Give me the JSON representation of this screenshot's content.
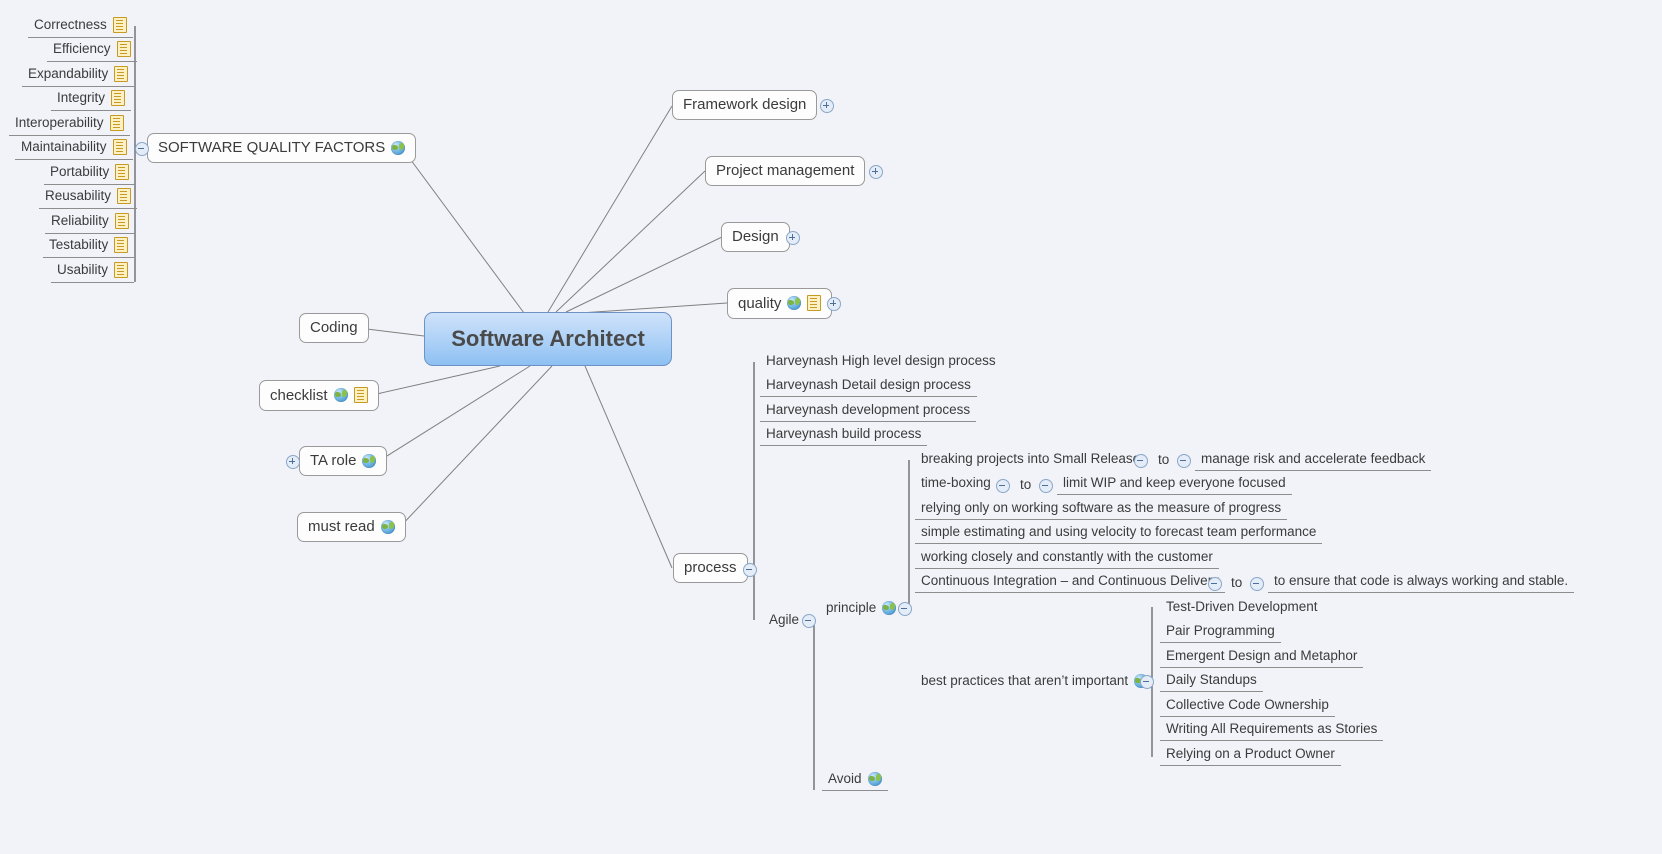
{
  "app": {
    "title": "Software Architect",
    "background_color": "#f1f3f8",
    "central_fill": "#9ecbf4",
    "node_border": "#9a9a9a",
    "link_color": "#808080"
  },
  "central": {
    "label": "Software Architect"
  },
  "quality_factors": {
    "title": "SOFTWARE QUALITY FACTORS",
    "toggle": "minus",
    "icons": [
      "globe-icon"
    ],
    "items": [
      {
        "label": "Correctness",
        "icons": [
          "note-icon"
        ]
      },
      {
        "label": "Efficiency",
        "icons": [
          "note-icon"
        ]
      },
      {
        "label": "Expandability",
        "icons": [
          "note-icon"
        ]
      },
      {
        "label": "Integrity",
        "icons": [
          "note-icon"
        ]
      },
      {
        "label": "Interoperability",
        "icons": [
          "note-icon"
        ]
      },
      {
        "label": "Maintainability",
        "icons": [
          "note-icon"
        ]
      },
      {
        "label": "Portability",
        "icons": [
          "note-icon"
        ]
      },
      {
        "label": "Reusability",
        "icons": [
          "note-icon"
        ]
      },
      {
        "label": "Reliability",
        "icons": [
          "note-icon"
        ]
      },
      {
        "label": "Testability",
        "icons": [
          "note-icon"
        ]
      },
      {
        "label": "Usability",
        "icons": [
          "note-icon"
        ]
      }
    ]
  },
  "branches": {
    "framework_design": {
      "label": "Framework design",
      "toggle": "plus"
    },
    "project_management": {
      "label": "Project management",
      "toggle": "plus"
    },
    "design": {
      "label": "Design",
      "toggle": "plus"
    },
    "quality": {
      "label": "quality",
      "toggle": "plus",
      "icons": [
        "globe-icon",
        "note-icon"
      ]
    },
    "coding": {
      "label": "Coding"
    },
    "checklist": {
      "label": "checklist",
      "icons": [
        "globe-icon",
        "note-icon"
      ]
    },
    "ta_role": {
      "label": "TA role",
      "toggle": "plus",
      "icons": [
        "globe-icon"
      ]
    },
    "must_read": {
      "label": "must read",
      "icons": [
        "globe-icon"
      ]
    },
    "process": {
      "label": "process",
      "toggle": "minus"
    }
  },
  "process": {
    "harveynash": [
      {
        "label": "Harveynash High level design process"
      },
      {
        "label": "Harveynash Detail design process"
      },
      {
        "label": "Harveynash development process"
      },
      {
        "label": "Harveynash build process"
      }
    ],
    "agile": {
      "label": "Agile",
      "toggle": "minus",
      "principle": {
        "label": "principle",
        "toggle": "minus",
        "icons": [
          "globe-icon"
        ],
        "items": [
          {
            "label": "breaking projects into Small Releases",
            "toggle": "minus",
            "relation": "to",
            "relation_toggle": "minus",
            "target": "manage risk and accelerate feedback"
          },
          {
            "label": "time-boxing",
            "toggle": "minus",
            "relation": "to",
            "relation_toggle": "minus",
            "target": "limit WIP and keep everyone focused"
          },
          {
            "label": "relying only on working software as the measure of progress"
          },
          {
            "label": "simple estimating and using velocity to forecast team performance"
          },
          {
            "label": "working closely and constantly with the customer"
          },
          {
            "label": "Continuous Integration – and Continuous Delivery",
            "toggle": "minus",
            "relation": "to",
            "relation_toggle": "minus",
            "target": "to ensure that code is always working and stable."
          }
        ]
      },
      "best_practices": {
        "label": "best practices that aren’t important",
        "toggle": "minus",
        "icons": [
          "globe-icon"
        ],
        "items": [
          {
            "label": "Test-Driven Development"
          },
          {
            "label": "Pair Programming"
          },
          {
            "label": "Emergent Design and Metaphor"
          },
          {
            "label": "Daily Standups"
          },
          {
            "label": "Collective Code Ownership"
          },
          {
            "label": "Writing All Requirements as Stories"
          },
          {
            "label": "Relying on a Product Owner"
          }
        ]
      },
      "avoid": {
        "label": "Avoid",
        "icons": [
          "globe-icon"
        ]
      }
    }
  }
}
